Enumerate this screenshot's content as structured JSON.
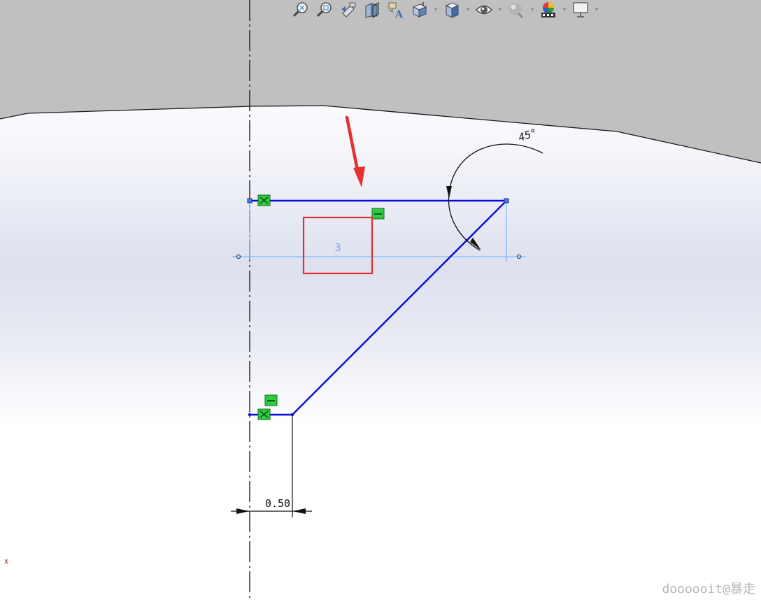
{
  "toolbar": {
    "items": [
      {
        "icon": "zoom-to-fit-icon",
        "has_dropdown": false
      },
      {
        "icon": "zoom-to-area-icon",
        "has_dropdown": false
      },
      {
        "icon": "previous-view-icon",
        "has_dropdown": false
      },
      {
        "icon": "section-view-icon",
        "has_dropdown": false
      },
      {
        "icon": "dynamic-annotation-view-icon",
        "has_dropdown": false
      },
      {
        "icon": "view-orientation-icon",
        "has_dropdown": true
      },
      {
        "icon": "display-style-icon",
        "has_dropdown": true
      },
      {
        "icon": "hide-show-items-icon",
        "has_dropdown": true
      },
      {
        "icon": "edit-appearance-icon",
        "has_dropdown": true
      },
      {
        "icon": "apply-scene-icon",
        "has_dropdown": true
      },
      {
        "icon": "view-settings-icon",
        "has_dropdown": true
      }
    ]
  },
  "sketch": {
    "angle_dimension": "45°",
    "driven_dimension": "3",
    "linear_dimension": "0.50",
    "line_color": "#0a0adc",
    "relation_color": "#2ecc40",
    "highlight_color": "#e03030"
  },
  "origin_label": "x",
  "watermark": "doooooit@暴走"
}
